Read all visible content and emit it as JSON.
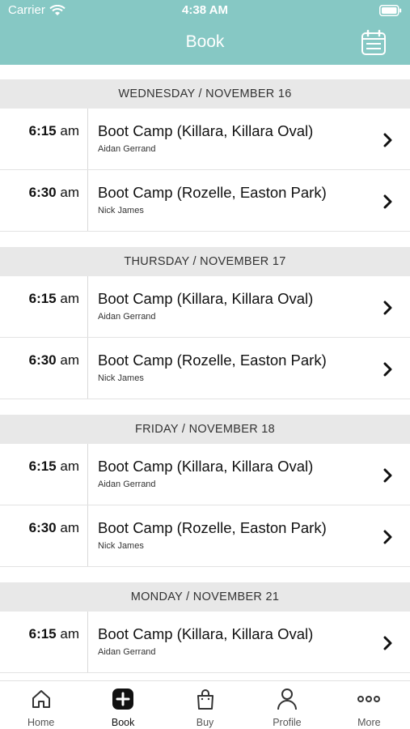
{
  "status_bar": {
    "carrier": "Carrier",
    "time": "4:38 AM"
  },
  "header": {
    "title": "Book",
    "accent_color": "#86c8c4"
  },
  "schedule": [
    {
      "day": "WEDNESDAY / NOVEMBER 16",
      "classes": [
        {
          "time": "6:15",
          "ampm": "am",
          "title": "Boot Camp (Killara, Killara Oval)",
          "coach": "Aidan Gerrand"
        },
        {
          "time": "6:30",
          "ampm": "am",
          "title": "Boot Camp (Rozelle, Easton Park)",
          "coach": "Nick James"
        }
      ]
    },
    {
      "day": "THURSDAY / NOVEMBER 17",
      "classes": [
        {
          "time": "6:15",
          "ampm": "am",
          "title": "Boot Camp (Killara, Killara Oval)",
          "coach": "Aidan Gerrand"
        },
        {
          "time": "6:30",
          "ampm": "am",
          "title": "Boot Camp (Rozelle, Easton Park)",
          "coach": "Nick James"
        }
      ]
    },
    {
      "day": "FRIDAY / NOVEMBER 18",
      "classes": [
        {
          "time": "6:15",
          "ampm": "am",
          "title": "Boot Camp (Killara, Killara Oval)",
          "coach": "Aidan Gerrand"
        },
        {
          "time": "6:30",
          "ampm": "am",
          "title": "Boot Camp (Rozelle, Easton Park)",
          "coach": "Nick James"
        }
      ]
    },
    {
      "day": "MONDAY / NOVEMBER 21",
      "classes": [
        {
          "time": "6:15",
          "ampm": "am",
          "title": "Boot Camp (Killara, Killara Oval)",
          "coach": "Aidan Gerrand"
        }
      ]
    }
  ],
  "tabs": [
    {
      "label": "Home",
      "icon": "home-icon",
      "active": false
    },
    {
      "label": "Book",
      "icon": "plus-icon",
      "active": true
    },
    {
      "label": "Buy",
      "icon": "shopping-bag-icon",
      "active": false
    },
    {
      "label": "Profile",
      "icon": "user-icon",
      "active": false
    },
    {
      "label": "More",
      "icon": "more-icon",
      "active": false
    }
  ]
}
